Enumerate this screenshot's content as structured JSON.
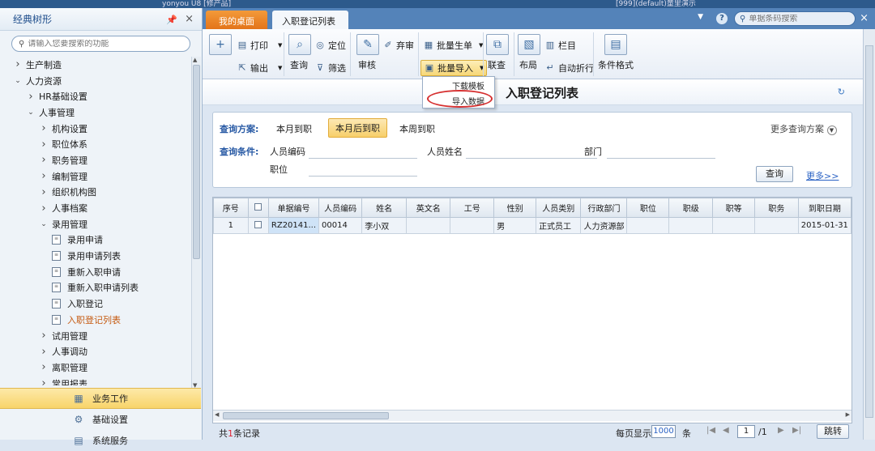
{
  "window": {
    "title_left": "yonyou U8 [修产品]",
    "title_right": "[999](default)童里演示"
  },
  "sidebar": {
    "title": "经典树形",
    "pin_icon": "📌",
    "search_placeholder": "请输入您要搜索的功能",
    "tree": [
      {
        "label": "生产制造",
        "kind": "collapsed",
        "level": 1
      },
      {
        "label": "人力资源",
        "kind": "expanded",
        "level": 1
      },
      {
        "label": "HR基础设置",
        "kind": "collapsed",
        "level": 2
      },
      {
        "label": "人事管理",
        "kind": "expanded",
        "level": 2
      },
      {
        "label": "机构设置",
        "kind": "collapsed",
        "level": 3
      },
      {
        "label": "职位体系",
        "kind": "collapsed",
        "level": 3
      },
      {
        "label": "职务管理",
        "kind": "collapsed",
        "level": 3
      },
      {
        "label": "编制管理",
        "kind": "collapsed",
        "level": 3
      },
      {
        "label": "组织机构图",
        "kind": "collapsed",
        "level": 3
      },
      {
        "label": "人事档案",
        "kind": "collapsed",
        "level": 3
      },
      {
        "label": "录用管理",
        "kind": "expanded",
        "level": 3
      },
      {
        "label": "录用申请",
        "kind": "doc",
        "level": 4
      },
      {
        "label": "录用申请列表",
        "kind": "doc",
        "level": 4
      },
      {
        "label": "重新入职申请",
        "kind": "doc",
        "level": 4
      },
      {
        "label": "重新入职申请列表",
        "kind": "doc",
        "level": 4
      },
      {
        "label": "入职登记",
        "kind": "doc",
        "level": 4
      },
      {
        "label": "入职登记列表",
        "kind": "doc",
        "level": 4,
        "active": true
      },
      {
        "label": "试用管理",
        "kind": "collapsed",
        "level": 3
      },
      {
        "label": "人事调动",
        "kind": "collapsed",
        "level": 3
      },
      {
        "label": "离职管理",
        "kind": "collapsed",
        "level": 3
      },
      {
        "label": "常用报表",
        "kind": "collapsed",
        "level": 3
      }
    ],
    "bottom": [
      {
        "label": "业务工作",
        "selected": true
      },
      {
        "label": "基础设置",
        "selected": false
      },
      {
        "label": "系统服务",
        "selected": false
      }
    ]
  },
  "tabs": {
    "home": "我的桌面",
    "current": "入职登记列表",
    "search_placeholder": "单据条码搜索"
  },
  "toolbar": {
    "print": "打印",
    "export": "输出",
    "locate": "定位",
    "query": "查询",
    "filter": "筛选",
    "audit": "审核",
    "abandon": "弃审",
    "batch_generate": "批量生单",
    "batch_import": "批量导入",
    "join_query": "联查",
    "layout": "布局",
    "columns": "栏目",
    "auto_wrap": "自动折行",
    "conditional_format": "条件格式"
  },
  "dropdown": {
    "items": [
      "下载模板",
      "导入数据"
    ]
  },
  "page": {
    "title": "入职登记列表"
  },
  "query": {
    "scheme_label": "查询方案:",
    "schemes": [
      "本月到职",
      "本月后到职",
      "本周到职"
    ],
    "active_scheme": 1,
    "more_schemes": "更多查询方案",
    "cond_label": "查询条件:",
    "fields": [
      "人员编码",
      "人员姓名",
      "部门",
      "职位"
    ],
    "query_button": "查询",
    "more_link": "更多>>"
  },
  "grid": {
    "columns": [
      "序号",
      "",
      "单据编号",
      "人员编码",
      "姓名",
      "英文名",
      "工号",
      "性别",
      "人员类别",
      "行政部门",
      "职位",
      "职级",
      "职等",
      "职务",
      "到职日期"
    ],
    "rows": [
      [
        "1",
        "",
        "RZ20141...",
        "00014",
        "李小双",
        "",
        "",
        "男",
        "正式员工",
        "人力资源部",
        "",
        "",
        "",
        "",
        "2015-01-31"
      ]
    ]
  },
  "footer": {
    "count_prefix": "共",
    "count": "1",
    "count_suffix": "条记录",
    "per_page_label": "每页显示",
    "per_page": "1000",
    "per_page_unit": "条",
    "page": "1",
    "total_pages": "/1",
    "jump": "跳转"
  },
  "colors": {
    "accent": "#5483b9",
    "home_tab": "#e3741a",
    "highlight": "#f7d777",
    "circle": "#d63030"
  }
}
